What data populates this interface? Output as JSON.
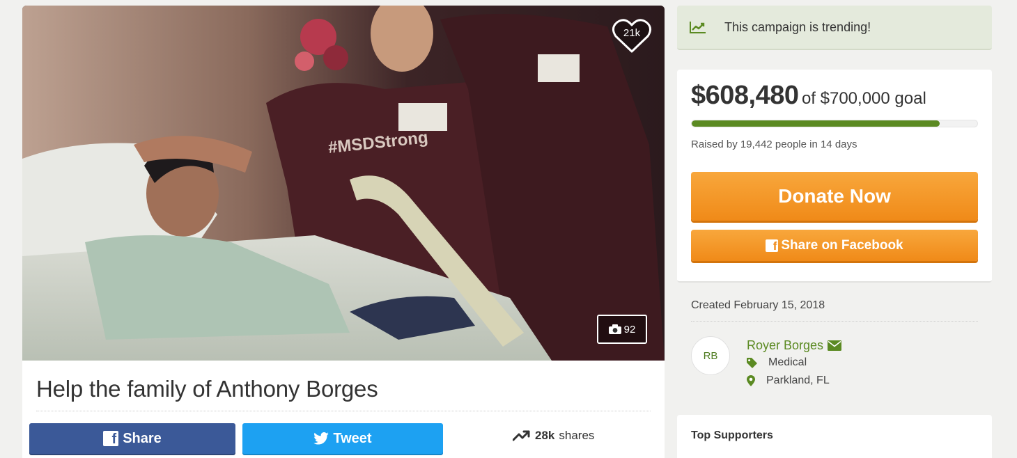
{
  "campaign": {
    "title": "Help the family of Anthony Borges",
    "likes": "21k",
    "photo_count": "92"
  },
  "social": {
    "share_label": "Share",
    "tweet_label": "Tweet",
    "shares_count": "28k",
    "shares_suffix": "shares",
    "facebook_color": "#3b5998",
    "twitter_color": "#1da1f2"
  },
  "trending": {
    "text": "This campaign is trending!",
    "icon": "trending-chart-icon"
  },
  "donation": {
    "raised": "$608,480",
    "goal_text": "of $700,000 goal",
    "progress_fraction": 0.869,
    "raised_by": "Raised by 19,442 people in 14 days",
    "donate_label": "Donate Now",
    "share_fb_label": "Share on Facebook",
    "accent_color": "#5b8a22",
    "button_color": "#f39a26"
  },
  "organizer": {
    "created": "Created February 15, 2018",
    "initials": "RB",
    "name": "Royer Borges",
    "category": "Medical",
    "location": "Parkland, FL"
  },
  "supporters": {
    "heading": "Top Supporters"
  }
}
